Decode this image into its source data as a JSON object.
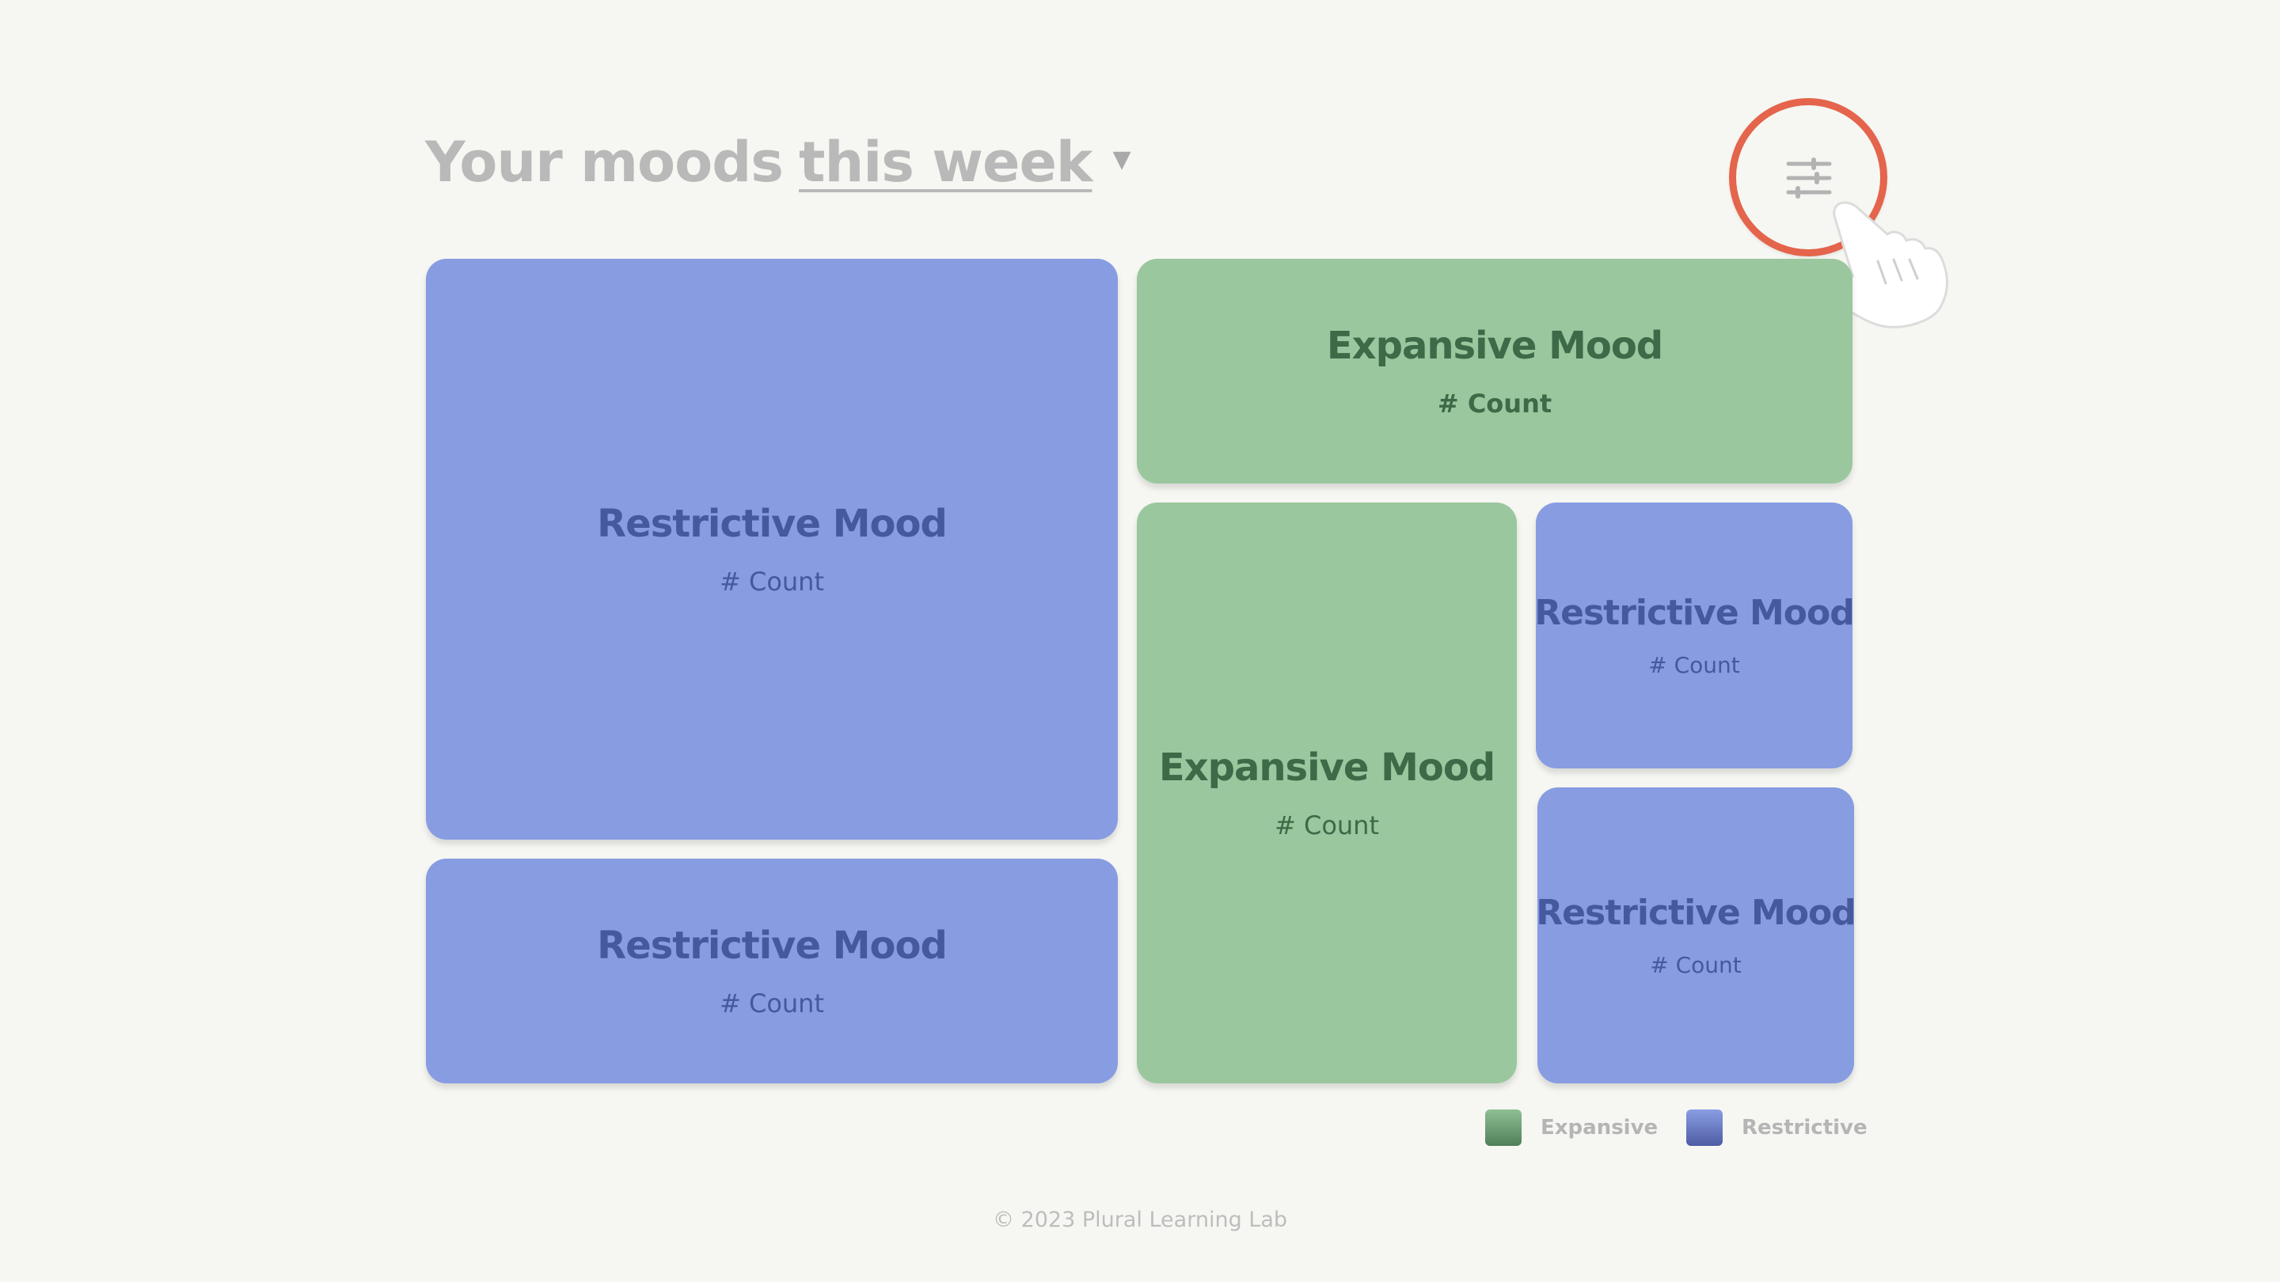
{
  "header": {
    "title_prefix": "Your moods",
    "period": "this week",
    "caret": "▼"
  },
  "filter": {
    "icon": "sliders-icon",
    "highlight_color": "#e4644c"
  },
  "tiles": [
    {
      "type": "restrictive",
      "name": "Restrictive Mood",
      "count": "# Count"
    },
    {
      "type": "restrictive",
      "name": "Restrictive Mood",
      "count": "# Count"
    },
    {
      "type": "expansive",
      "name": "Expansive Mood",
      "count": "# Count"
    },
    {
      "type": "expansive",
      "name": "Expansive Mood",
      "count": "# Count"
    },
    {
      "type": "restrictive",
      "name": "Restrictive Mood",
      "count": "# Count"
    },
    {
      "type": "restrictive",
      "name": "Restrictive Mood",
      "count": "# Count"
    }
  ],
  "legend": {
    "expansive": {
      "label": "Expansive",
      "color": "#5d8d66"
    },
    "restrictive": {
      "label": "Restrictive",
      "color": "#5b6bb0"
    }
  },
  "colors": {
    "restrictive_tile": "#889ce2",
    "expansive_tile": "#9bc79e",
    "background": "#f6f7f2"
  },
  "footer": {
    "copyright": "© 2023 Plural Learning Lab"
  }
}
